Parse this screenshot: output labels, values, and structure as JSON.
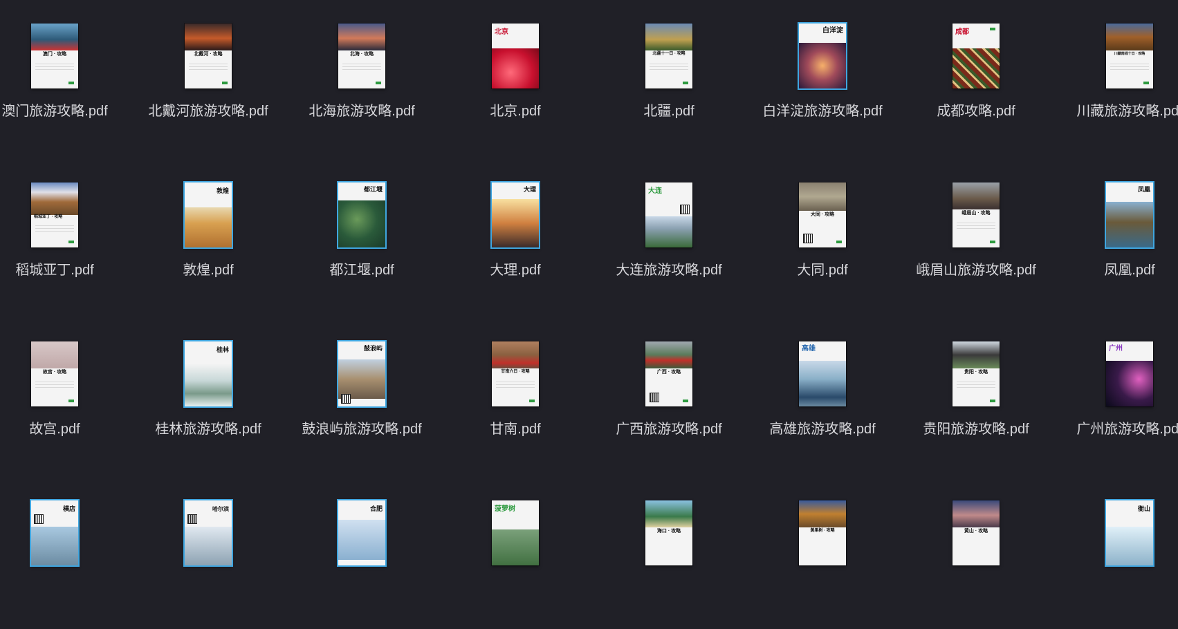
{
  "files": [
    {
      "name": "澳门旅游攻略.pdf",
      "thumb_title": "澳门 · 攻略"
    },
    {
      "name": "北戴河旅游攻略.pdf",
      "thumb_title": "北戴河 · 攻略"
    },
    {
      "name": "北海旅游攻略.pdf",
      "thumb_title": "北海 · 攻略"
    },
    {
      "name": "北京.pdf",
      "thumb_title": "北京"
    },
    {
      "name": "北疆.pdf",
      "thumb_title": "北疆十一日 · 攻略"
    },
    {
      "name": "白洋淀旅游攻略.pdf",
      "thumb_title": "白洋淀"
    },
    {
      "name": "成都攻略.pdf",
      "thumb_title": "成都"
    },
    {
      "name": "川藏旅游攻略.pdf",
      "thumb_title": "川藏南线十日 · 攻略"
    },
    {
      "name": "稻城亚丁.pdf",
      "thumb_title": "稻城亚丁 · 攻略"
    },
    {
      "name": "敦煌.pdf",
      "thumb_title": "敦煌"
    },
    {
      "name": "都江堰.pdf",
      "thumb_title": "都江堰"
    },
    {
      "name": "大理.pdf",
      "thumb_title": "大理"
    },
    {
      "name": "大连旅游攻略.pdf",
      "thumb_title": "大连"
    },
    {
      "name": "大同.pdf",
      "thumb_title": "大同 · 攻略"
    },
    {
      "name": "峨眉山旅游攻略.pdf",
      "thumb_title": "峨眉山 · 攻略"
    },
    {
      "name": "凤凰.pdf",
      "thumb_title": "凤凰"
    },
    {
      "name": "故宫.pdf",
      "thumb_title": "故宫 · 攻略"
    },
    {
      "name": "桂林旅游攻略.pdf",
      "thumb_title": "桂林"
    },
    {
      "name": "鼓浪屿旅游攻略.pdf",
      "thumb_title": "鼓浪屿"
    },
    {
      "name": "甘南.pdf",
      "thumb_title": "甘南六日 · 攻略"
    },
    {
      "name": "广西旅游攻略.pdf",
      "thumb_title": "广西 · 攻略"
    },
    {
      "name": "高雄旅游攻略.pdf",
      "thumb_title": "高雄"
    },
    {
      "name": "贵阳旅游攻略.pdf",
      "thumb_title": "贵阳 · 攻略"
    },
    {
      "name": "广州旅游攻略.pdf",
      "thumb_title": "广州"
    },
    {
      "name": "",
      "thumb_title": "横店"
    },
    {
      "name": "",
      "thumb_title": "哈尔滨"
    },
    {
      "name": "",
      "thumb_title": "合肥"
    },
    {
      "name": "",
      "thumb_title": "菠萝树"
    },
    {
      "name": "",
      "thumb_title": "海口 · 攻略"
    },
    {
      "name": "",
      "thumb_title": "黄果树 · 攻略"
    },
    {
      "name": "",
      "thumb_title": "黄山 · 攻略"
    },
    {
      "name": "",
      "thumb_title": "衡山"
    }
  ],
  "colors": {
    "background": "#202027",
    "label": "#d6d6da",
    "accent_border": "#3fa6e0"
  }
}
